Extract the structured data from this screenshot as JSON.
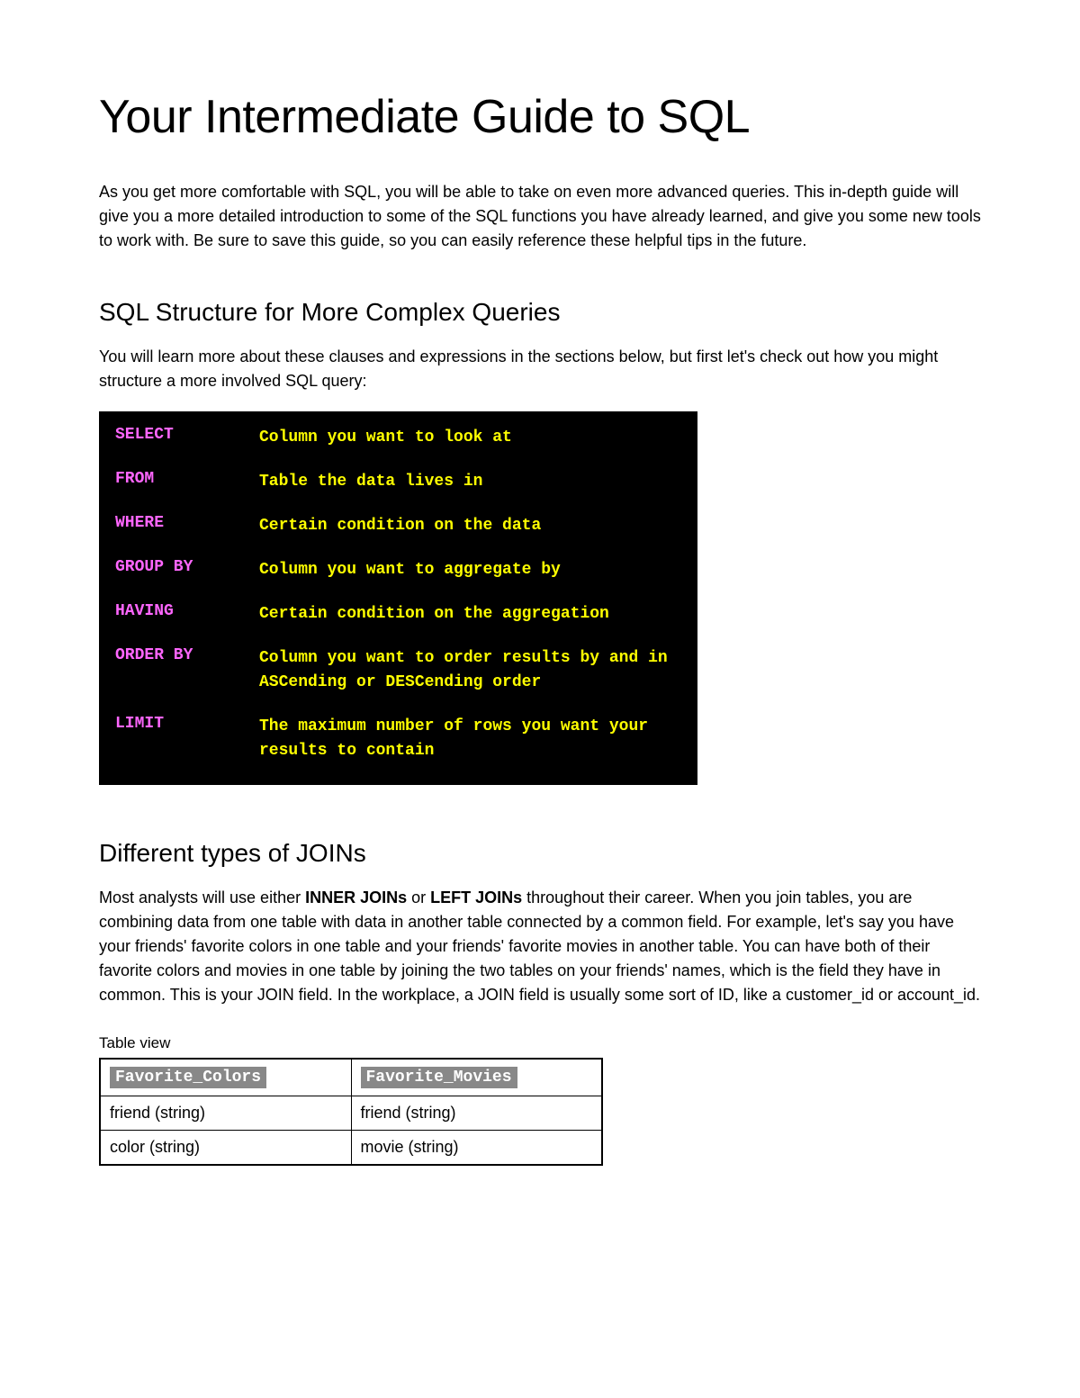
{
  "title": "Your Intermediate Guide to SQL",
  "intro": "As you get more comfortable with SQL, you will be able to take on even more advanced queries. This in-depth guide will give you a more detailed introduction to some of the SQL functions you have already learned, and give you some new tools to work with. Be sure to save this guide, so you can easily reference these helpful tips in the future.",
  "section1": {
    "heading": "SQL Structure for More Complex Queries",
    "body": "You will learn more about these clauses and expressions in the sections below, but first let's check out how you might structure a more involved SQL query:"
  },
  "sql_structure": [
    {
      "keyword": "SELECT",
      "description": "Column you want to look at"
    },
    {
      "keyword": "FROM",
      "description": "Table the data lives in"
    },
    {
      "keyword": "WHERE",
      "description": "Certain condition on the data"
    },
    {
      "keyword": "GROUP BY",
      "description": "Column you want to aggregate by"
    },
    {
      "keyword": "HAVING",
      "description": "Certain condition on the aggregation"
    },
    {
      "keyword": "ORDER BY",
      "description": "Column you want to order results by and in ASCending or DESCending order"
    },
    {
      "keyword": "LIMIT",
      "description": "The maximum number of rows you want your results to contain"
    }
  ],
  "section2": {
    "heading": "Different types of JOINs",
    "body_pre": "Most analysts will use either ",
    "bold1": "INNER JOINs",
    "body_mid": " or ",
    "bold2": "LEFT JOINs",
    "body_post": " throughout their career. When you join tables, you are combining data from one table with data in another table connected by a common field. For example, let's say you have your friends' favorite colors in one table and your friends' favorite movies in another table. You can have both of their favorite colors and movies in one table by joining the two tables on your friends' names, which is the field they have in common. This is your JOIN field. In the workplace, a JOIN field is usually some sort of ID, like a customer_id or account_id."
  },
  "table": {
    "caption": "Table view",
    "headers": [
      "Favorite_Colors",
      "Favorite_Movies"
    ],
    "rows": [
      [
        "friend (string)",
        "friend (string)"
      ],
      [
        "color (string)",
        "movie (string)"
      ]
    ]
  }
}
